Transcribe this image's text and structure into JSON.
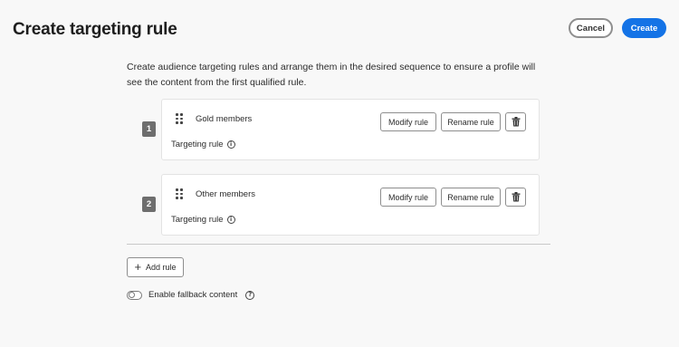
{
  "header": {
    "title": "Create targeting rule",
    "cancel_label": "Cancel",
    "create_label": "Create",
    "accent_color": "#1473e6"
  },
  "description": "Create audience targeting rules and arrange them in the desired sequence to ensure a profile will see the content from the first qualified rule.",
  "rules": [
    {
      "number": "1",
      "name": "Gold members",
      "subtitle": "Targeting rule",
      "modify_label": "Modify rule",
      "rename_label": "Rename rule",
      "icons": [
        "drag-handle-icon",
        "info-icon",
        "trash-icon"
      ]
    },
    {
      "number": "2",
      "name": "Other members",
      "subtitle": "Targeting rule",
      "modify_label": "Modify rule",
      "rename_label": "Rename rule",
      "icons": [
        "drag-handle-icon",
        "info-icon",
        "trash-icon"
      ]
    }
  ],
  "footer": {
    "add_rule_label": "Add rule",
    "fallback_label": "Enable fallback content",
    "fallback_enabled": false
  }
}
